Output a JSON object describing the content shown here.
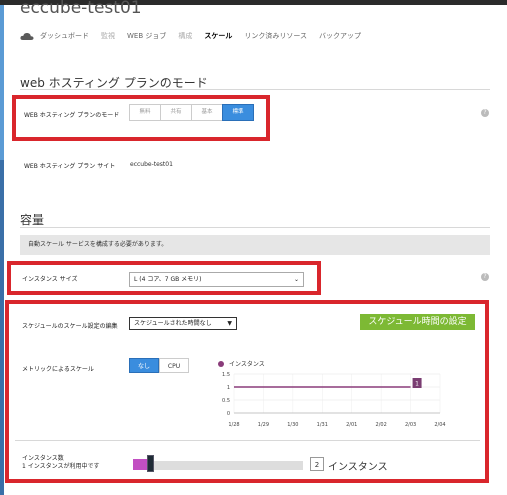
{
  "site": {
    "title": "eccube-test01"
  },
  "nav": {
    "items": [
      {
        "label": "ダッシュボード",
        "state": "normal"
      },
      {
        "label": "監視",
        "state": "dim"
      },
      {
        "label": "WEB ジョブ",
        "state": "normal"
      },
      {
        "label": "構成",
        "state": "dim"
      },
      {
        "label": "スケール",
        "state": "active"
      },
      {
        "label": "リンク済みリソース",
        "state": "normal"
      },
      {
        "label": "バックアップ",
        "state": "normal"
      }
    ]
  },
  "plan_section": {
    "title": "web ホスティング プランのモード",
    "mode_label": "WEB ホスティング プランのモード",
    "modes": [
      "無料",
      "共有",
      "基本",
      "標準"
    ],
    "selected_mode": "標準",
    "site_label": "WEB ホスティング プラン サイト",
    "site_value": "eccube-test01"
  },
  "capacity_section": {
    "title": "容量",
    "notice": "自動スケール サービスを構成する必要があります。",
    "instance_size_label": "インスタンス サイズ",
    "instance_size_value": "L (4 コア、7 GB メモリ)",
    "schedule_label": "スケジュールのスケール設定の編集",
    "schedule_value": "スケジュールされた時間なし",
    "schedule_badge": "スケジュール時間の設定",
    "metric_label": "メトリックによるスケール",
    "metric_options": [
      "なし",
      "CPU"
    ],
    "metric_selected": "なし",
    "instance_count_label_line1": "インスタンス数",
    "instance_count_label_line2": "1 インスタンスが利用中です",
    "instance_count_value": "2",
    "instance_count_unit": "インスタンス"
  },
  "chart_data": {
    "type": "line",
    "series": [
      {
        "name": "インスタンス",
        "values": [
          1,
          1,
          1,
          1,
          1,
          1,
          1
        ]
      }
    ],
    "categories": [
      "1/28",
      "1/29",
      "1/30",
      "1/31",
      "2/01",
      "2/02",
      "2/03",
      "2/04"
    ],
    "yticks": [
      "0",
      "0.5",
      "1",
      "1.5"
    ],
    "ylim": [
      0,
      1.5
    ],
    "end_label": "1",
    "colors": {
      "series": "#8a3c7a"
    }
  },
  "colors": {
    "accent": "#3a8dde",
    "highlight_box": "#d9262c",
    "badge": "#7db934",
    "slider_fill": "#c24fc2"
  }
}
